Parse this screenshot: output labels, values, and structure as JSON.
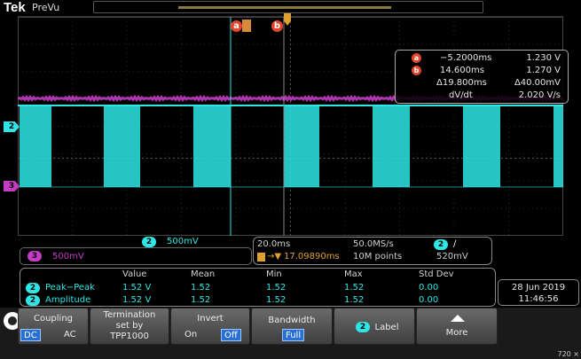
{
  "header": {
    "brand": "Tek",
    "mode": "PreVu"
  },
  "cursors": {
    "a_label": "a",
    "b_label": "b",
    "readout": {
      "a_time": "−5.2000ms",
      "a_volt": "1.230 V",
      "b_time": "14.600ms",
      "b_volt": "1.270 V",
      "dt": "Δ19.800ms",
      "dv": "Δ40.00mV",
      "slope_label": "dV/dt",
      "slope": "2.020 V/s"
    }
  },
  "channels": {
    "ch2": {
      "num": "2",
      "scale": "500mV",
      "color": "#2ee6e6"
    },
    "ch3": {
      "num": "3",
      "scale": "500mV",
      "color": "#c43bc4"
    }
  },
  "acquisition": {
    "timebase": "20.0ms",
    "sample_rate": "50.0MS/s",
    "trigger_pos": "17.09890ms",
    "record": "10M points",
    "trigger_ch": "2",
    "trigger_slope": "∕",
    "trigger_level": "520mV"
  },
  "measurements": {
    "headers": [
      "Value",
      "Mean",
      "Min",
      "Max",
      "Std Dev"
    ],
    "rows": [
      {
        "ch": "2",
        "name": "Peak−Peak",
        "value": "1.52 V",
        "mean": "1.52",
        "min": "1.52",
        "max": "1.52",
        "std": "0.00"
      },
      {
        "ch": "2",
        "name": "Amplitude",
        "value": "1.52 V",
        "mean": "1.52",
        "min": "1.52",
        "max": "1.52",
        "std": "0.00"
      }
    ]
  },
  "datetime": {
    "date": "28 Jun 2019",
    "time": "11:46:56"
  },
  "menu": {
    "coupling": {
      "label": "Coupling",
      "opt1": "DC",
      "opt2": "AC"
    },
    "termination": {
      "line1": "Termination",
      "line2": "set by",
      "line3": "TPP1000"
    },
    "invert": {
      "label": "Invert",
      "opt1": "On",
      "opt2": "Off"
    },
    "bandwidth": {
      "label": "Bandwidth",
      "value": "Full"
    },
    "label_btn": {
      "ch": "2",
      "label": "Label"
    },
    "more": {
      "label": "More"
    }
  },
  "resolution": "720 ×"
}
